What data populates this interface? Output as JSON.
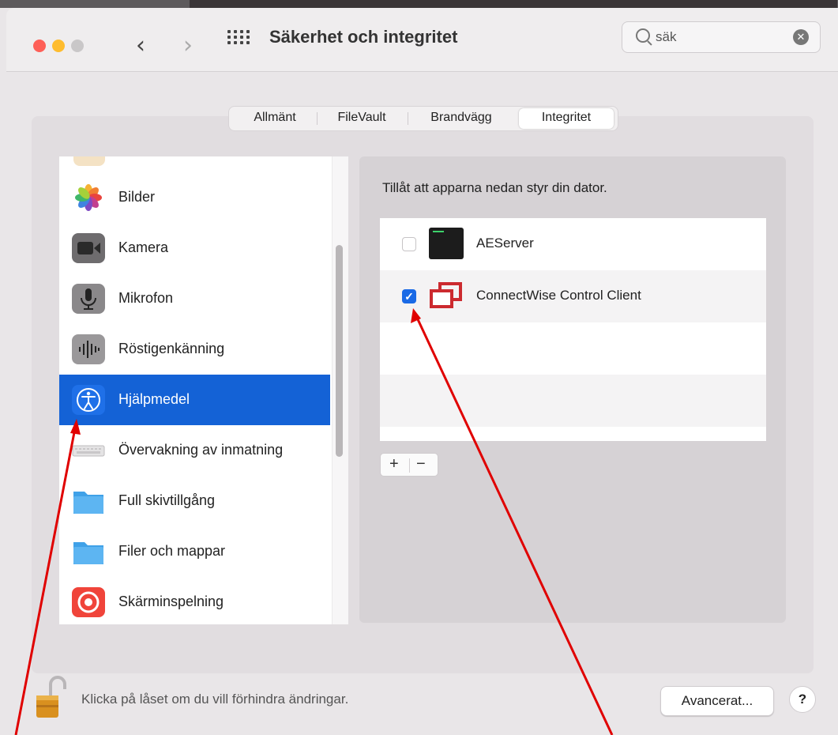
{
  "window": {
    "title": "Säkerhet och integritet",
    "search": {
      "value": "säk",
      "icon": "search-icon"
    }
  },
  "tabs": [
    {
      "label": "Allmänt",
      "selected": false
    },
    {
      "label": "FileVault",
      "selected": false
    },
    {
      "label": "Brandvägg",
      "selected": false
    },
    {
      "label": "Integritet",
      "selected": true
    }
  ],
  "sidebar": {
    "items": [
      {
        "label": "Bilder",
        "icon": "photos-icon",
        "selected": false
      },
      {
        "label": "Kamera",
        "icon": "camera-icon",
        "selected": false
      },
      {
        "label": "Mikrofon",
        "icon": "microphone-icon",
        "selected": false
      },
      {
        "label": "Röstigenkänning",
        "icon": "speech-recognition-icon",
        "selected": false
      },
      {
        "label": "Hjälpmedel",
        "icon": "accessibility-icon",
        "selected": true
      },
      {
        "label": "Övervakning av inmatning",
        "icon": "keyboard-icon",
        "selected": false
      },
      {
        "label": "Full skivtillgång",
        "icon": "folder-icon",
        "selected": false
      },
      {
        "label": "Filer och mappar",
        "icon": "folder-icon",
        "selected": false
      },
      {
        "label": "Skärminspelning",
        "icon": "screen-recording-icon",
        "selected": false
      }
    ]
  },
  "main": {
    "description": "Tillåt att apparna nedan styr din dator.",
    "apps": [
      {
        "name": "AEServer",
        "checked": false,
        "icon": "terminal-app-icon"
      },
      {
        "name": "ConnectWise Control Client",
        "checked": true,
        "icon": "connectwise-icon"
      }
    ],
    "add_label": "+",
    "remove_label": "−"
  },
  "footer": {
    "lock_text": "Klicka på låset om du vill förhindra ändringar.",
    "advanced_label": "Avancerat...",
    "help_label": "?"
  },
  "colors": {
    "selection": "#1462d6",
    "checkbox_on": "#1a6ae6",
    "annotation_arrow": "#e00000"
  }
}
